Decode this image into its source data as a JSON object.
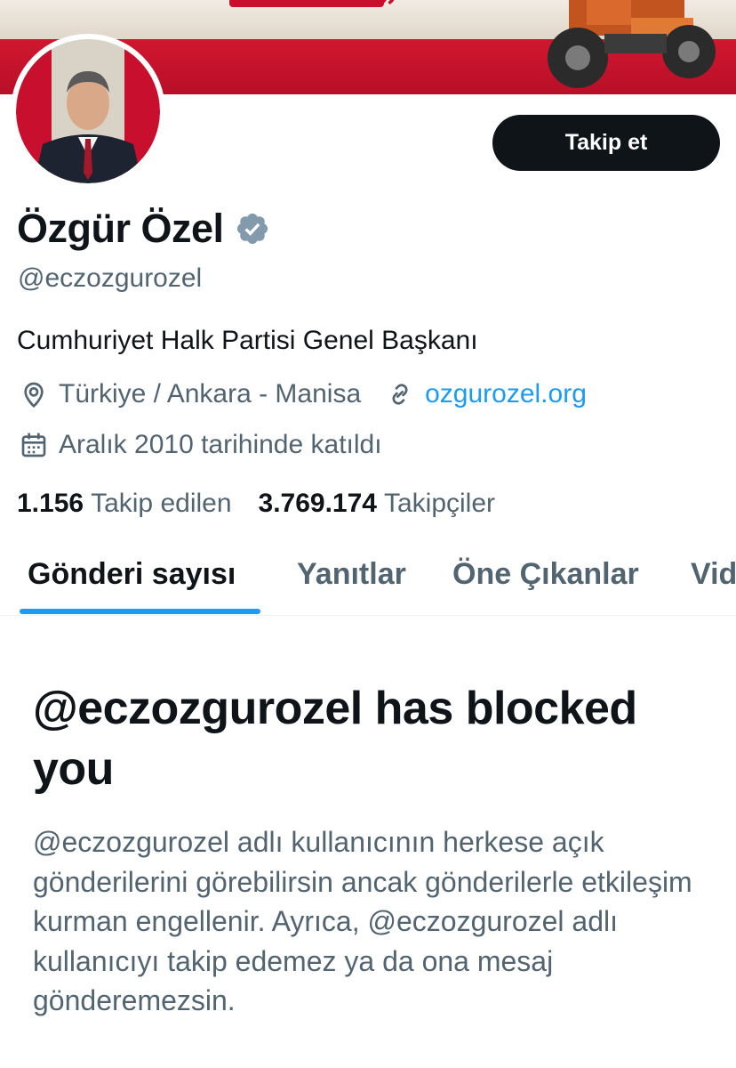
{
  "colors": {
    "accent": "#1d9bf0",
    "text_primary": "#0f1419",
    "text_secondary": "#536471",
    "banner_red": "#c8102e",
    "button_bg": "#0f1419"
  },
  "banner": {
    "icon": "profile-banner-image"
  },
  "profile": {
    "name": "Özgür Özel",
    "verified_icon": "verified-badge-icon",
    "handle": "@eczozgurozel",
    "bio": "Cumhuriyet Halk Partisi Genel Başkanı",
    "location": "Türkiye / Ankara - Manisa",
    "website": "ozgurozel.org",
    "joined": "Aralık 2010 tarihinde katıldı",
    "following_count": "1.156",
    "following_label": "Takip edilen",
    "followers_count": "3.769.174",
    "followers_label": "Takipçiler"
  },
  "actions": {
    "follow_label": "Takip et"
  },
  "tabs": [
    {
      "label": "Gönderi sayısı",
      "active": true
    },
    {
      "label": "Yanıtlar",
      "active": false
    },
    {
      "label": "Öne Çıkanlar",
      "active": false
    },
    {
      "label": "Vid",
      "active": false
    }
  ],
  "blocked": {
    "title": "@eczozgurozel has blocked you",
    "description": "@eczozgurozel adlı kullanıcının herkese açık gönderilerini görebilirsin ancak gönderilerle etkileşim kurman engellenir. Ayrıca, @eczozgurozel adlı kullanıcıyı takip edemez ya da ona mesaj gönderemezsin."
  }
}
